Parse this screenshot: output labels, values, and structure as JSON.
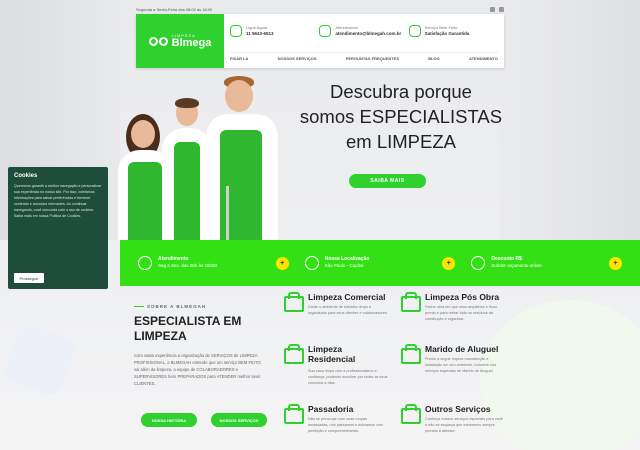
{
  "topbar": {
    "hours": "Segunda a Sexta-Feira das 08:00 às 18:00"
  },
  "header": {
    "logo_small": "LIMPEZA",
    "logo_text": "Blmega",
    "contacts": [
      {
        "label": "Ligue Agora",
        "value": "11 9643-6513"
      },
      {
        "label": "Atendimento",
        "value": "atendimento@blmegah.com.br"
      },
      {
        "label": "Serviço Bem Feito",
        "value": "Satisfação Garantida"
      }
    ],
    "nav": [
      "FIXAR LA",
      "NOSSOS SERVIÇOS",
      "PERGUNTAS FREQUENTES",
      "BLOG",
      "ATENDIMENTO"
    ]
  },
  "hero": {
    "line1": "Descubra porque",
    "line2": "somos ESPECIALISTAS",
    "line3": "em LIMPEZA",
    "button": "SAIBA MAIS"
  },
  "band": [
    {
      "title": "Atendimento",
      "text": "Seg a Sex. das 08h às 18h00",
      "plus": "+"
    },
    {
      "title": "Nossa Localização",
      "text": "São Paulo - Capital",
      "plus": "+"
    },
    {
      "title": "Desconto R$",
      "text": "Solicite orçamento online",
      "plus": "+"
    }
  ],
  "about": {
    "eyebrow": "SOBRE A BLMEGAH",
    "title": "ESPECIALISTA EM LIMPEZA",
    "text": "Com vasta experiência a organização de SERVIÇOS de LIMPEZA PROFISSIONAL, a BLMEGAH entende que um serviço BEM FEITO vai além da limpeza, a equipe de COLABORADORES e SUPERVISORES bem PREPARADOS para ATENDER melhor seus CLIENTES.",
    "btn1": "NOSSA HISTÓRIA",
    "btn2": "NOSSOS SERVIÇOS"
  },
  "services": [
    {
      "title": "Limpeza Comercial",
      "text": "Cuide o ambiente de trabalho limpo e organizado para seus clientes e colaboradores."
    },
    {
      "title": "Limpeza Pós Obra",
      "text": "Feche obra em que seus arquitetos e ficou pronto e para retirar todo os resíduos da construção e organizar."
    },
    {
      "title": "Limpeza Residencial",
      "text": "Sua casa limpa com a profissionalismo e confiança, podendo escolher por todas as seus cômodos e dias."
    },
    {
      "title": "Marido de Aluguel",
      "text": "Pronto a seguir impera manutenção e instalação em seu ambiente, inclusive nos serviços especiais de Marido de Aluguel."
    },
    {
      "title": "Passadoria",
      "text": "Não se preocupe com suas roupas amassadas, nós passamos e dobramos com perfeição e comprometimento."
    },
    {
      "title": "Outros Serviços",
      "text": "Conheça nossos serviços especiais para você e não se esqueça que estaremos sempre prontos a atender."
    }
  ],
  "cookie": {
    "title": "Cookies",
    "text": "Queremos garantir a melhor navegação e personalizar sua experiência no nosso site. Por isso, coletamos informações para salvar preferências e fornecer conteúdo e anúncios relevantes. Ao continuar navegando, você concorda com o uso de cookies. Saiba mais em nossa Política de Cookies.",
    "button": "Prosseguir"
  },
  "colors": {
    "brand_green": "#2fd12f",
    "band_green": "#32e014",
    "plus_yellow": "#ffe400",
    "cookie_bg": "#1e4d3b"
  }
}
